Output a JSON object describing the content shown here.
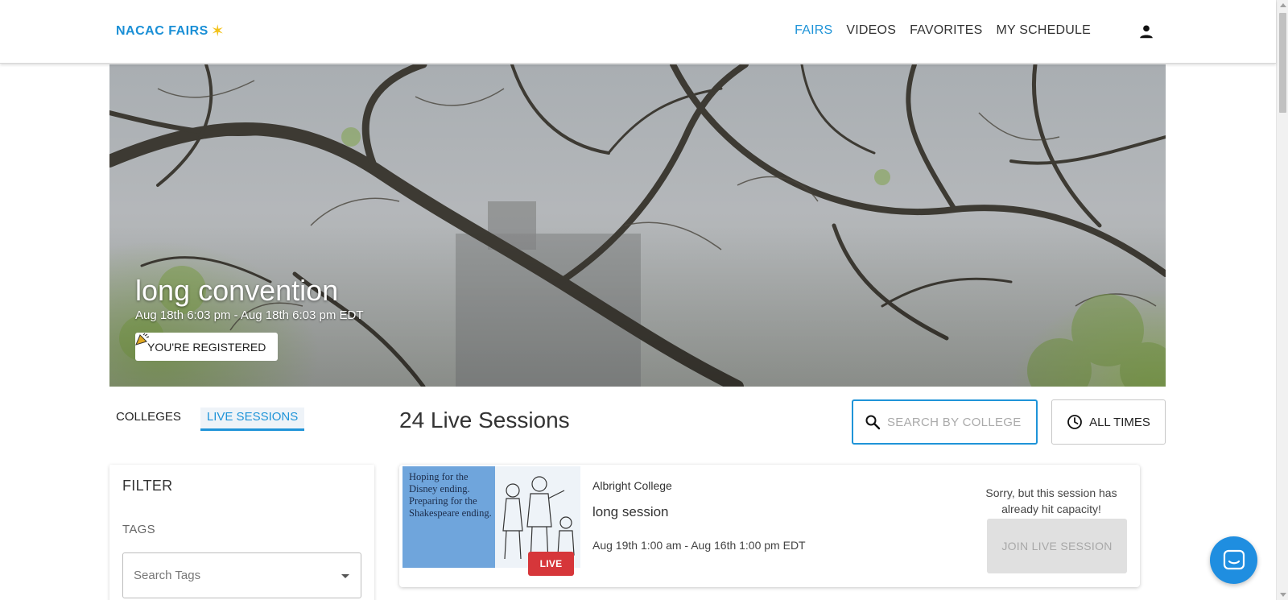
{
  "brand": {
    "logo_text": "NACAC FAIRS",
    "logo_star": "✶",
    "accent": "#1f94d8",
    "star_color": "#f2c21a"
  },
  "nav": {
    "items": [
      {
        "label": "FAIRS",
        "active": true
      },
      {
        "label": "VIDEOS",
        "active": false
      },
      {
        "label": "FAVORITES",
        "active": false
      },
      {
        "label": "MY SCHEDULE",
        "active": false
      }
    ],
    "account_icon": "account-icon"
  },
  "hero": {
    "title": "long convention",
    "dates": "Aug 18th 6:03 pm - Aug 18th 6:03 pm EDT",
    "registered_label": "YOU'RE REGISTERED",
    "registered_icon": "party-popper-icon"
  },
  "tabs": [
    {
      "label": "COLLEGES",
      "active": false
    },
    {
      "label": "LIVE SESSIONS",
      "active": true
    }
  ],
  "sessions": {
    "count_label": "24 Live Sessions"
  },
  "search": {
    "placeholder": "SEARCH BY COLLEGE",
    "value": "",
    "icon": "search-icon"
  },
  "time_filter": {
    "label": "ALL TIMES",
    "icon": "clock-icon"
  },
  "filter": {
    "title": "FILTER",
    "tags_label": "TAGS",
    "tags_placeholder": "Search Tags"
  },
  "session_card": {
    "thumb_text": "Hoping for the Disney ending. Preparing for the Shakespeare ending.",
    "live_badge": "LIVE",
    "college": "Albright College",
    "title": "long session",
    "dates": "Aug 19th 1:00 am - Aug 16th 1:00 pm EDT",
    "capacity_message": "Sorry, but this session has already hit capacity!",
    "join_label": "JOIN LIVE SESSION",
    "live_color": "#d6363a"
  },
  "chat": {
    "icon": "chat-icon"
  }
}
